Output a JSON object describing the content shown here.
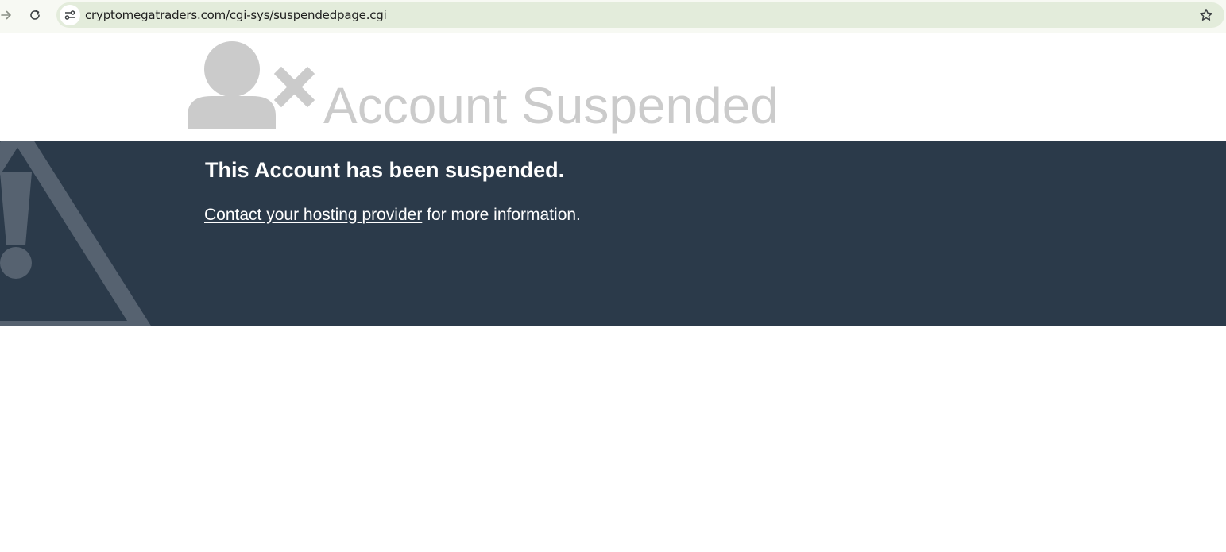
{
  "browser": {
    "url": "cryptomegatraders.com/cgi-sys/suspendedpage.cgi",
    "forward_icon": "arrow-right-icon",
    "reload_icon": "reload-icon",
    "site_info_icon": "tune-icon",
    "bookmark_icon": "star-icon"
  },
  "header": {
    "title": "Account Suspended",
    "icon": "user-x-icon"
  },
  "banner": {
    "heading": "This Account has been suspended.",
    "link_text": "Contact your hosting provider",
    "message_suffix": " for more information.",
    "icon": "warning-icon"
  },
  "colors": {
    "banner_background": "#2b3a4a",
    "title_gray": "#cbcbcb",
    "warning_gray": "#566270",
    "omnibox": "#e3ecdb"
  }
}
